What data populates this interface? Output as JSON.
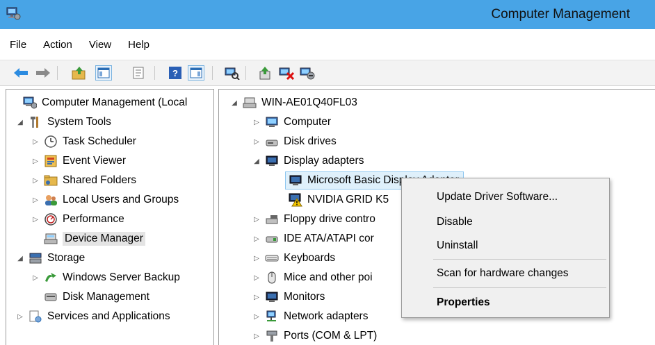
{
  "window": {
    "title": "Computer Management"
  },
  "menu": [
    "File",
    "Action",
    "View",
    "Help"
  ],
  "toolbar": [
    "back-icon",
    "forward-icon",
    "up-folder-icon",
    "show-hide-tree-icon",
    "properties-icon",
    "help-icon",
    "show-hide-action-pane-icon",
    "scan-hardware-icon",
    "update-driver-icon",
    "uninstall-device-icon",
    "disable-device-icon"
  ],
  "left_tree": {
    "root": "Computer Management (Local",
    "system_tools": "System Tools",
    "task_scheduler": "Task Scheduler",
    "event_viewer": "Event Viewer",
    "shared_folders": "Shared Folders",
    "local_users": "Local Users and Groups",
    "performance": "Performance",
    "device_manager": "Device Manager",
    "storage": "Storage",
    "windows_server_backup": "Windows Server Backup",
    "disk_management": "Disk Management",
    "services": "Services and Applications"
  },
  "device_tree": {
    "host": "WIN-AE01Q40FL03",
    "computer": "Computer",
    "disk_drives": "Disk drives",
    "display_adapters": "Display adapters",
    "ms_basic_display": "Microsoft Basic Display Adapter",
    "nvidia_grid": "NVIDIA GRID K5",
    "floppy": "Floppy drive contro",
    "ide": "IDE ATA/ATAPI cor",
    "keyboards": "Keyboards",
    "mice": "Mice and other poi",
    "monitors": "Monitors",
    "network": "Network adapters",
    "ports": "Ports (COM & LPT)"
  },
  "context_menu": {
    "update": "Update Driver Software...",
    "disable": "Disable",
    "uninstall": "Uninstall",
    "scan": "Scan for hardware changes",
    "properties": "Properties"
  },
  "colors": {
    "titlebar": "#48a4e6",
    "toolbar": "#f3f3f3",
    "menu_bg": "#f0f0f0",
    "selection": "#dff0fb"
  }
}
